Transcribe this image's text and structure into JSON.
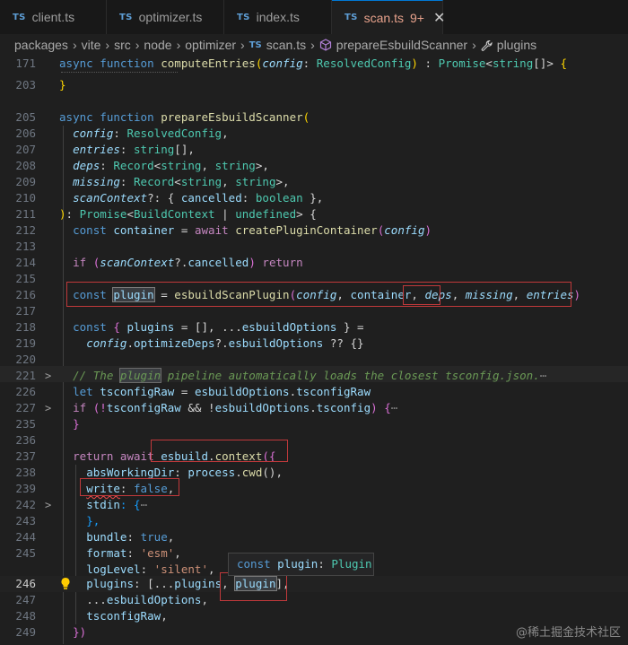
{
  "tabs": [
    {
      "icon": "TS",
      "label": "client.ts"
    },
    {
      "icon": "TS",
      "label": "optimizer.ts"
    },
    {
      "icon": "TS",
      "label": "index.ts"
    },
    {
      "icon": "TS",
      "label": "scan.ts",
      "problems": "9+",
      "close": "✕"
    }
  ],
  "breadcrumb": {
    "parts": [
      "packages",
      "vite",
      "src",
      "node",
      "optimizer"
    ],
    "file_icon": "TS",
    "file": "scan.ts",
    "symbol": "prepareEsbuildScanner",
    "symbol2": "plugins"
  },
  "line_numbers": [
    "171",
    "203",
    "205",
    "206",
    "207",
    "208",
    "209",
    "210",
    "211",
    "212",
    "213",
    "214",
    "215",
    "216",
    "217",
    "218",
    "219",
    "220",
    "221",
    "226",
    "227",
    "235",
    "236",
    "237",
    "238",
    "239",
    "242",
    "243",
    "244",
    "245",
    "246",
    "247",
    "248",
    "249"
  ],
  "code": {
    "l171": [
      "async",
      "function",
      "computeEntries",
      "(",
      "config",
      ":",
      "ResolvedConfig",
      ")",
      ":",
      "Promise",
      "<",
      "string",
      "[]>",
      "{"
    ],
    "l203": [
      "}"
    ],
    "l205": [
      "async",
      "function",
      "prepareEsbuildScanner",
      "("
    ],
    "l206": [
      "config",
      ": ",
      "ResolvedConfig",
      ","
    ],
    "l207": [
      "entries",
      ": ",
      "string",
      "[],"
    ],
    "l208": [
      "deps",
      ": ",
      "Record",
      "<",
      "string",
      ", ",
      "string",
      ">,"
    ],
    "l209": [
      "missing",
      ": ",
      "Record",
      "<",
      "string",
      ", ",
      "string",
      ">,"
    ],
    "l210": [
      "scanContext",
      "?: { ",
      "cancelled",
      ": ",
      "boolean",
      " },"
    ],
    "l211": [
      ")",
      ": ",
      "Promise",
      "<",
      "BuildContext",
      " | ",
      "undefined",
      "> {"
    ],
    "l212": [
      "const",
      "container",
      " = ",
      "await",
      "createPluginContainer",
      "(",
      "config",
      ")"
    ],
    "l214": [
      "if",
      " (",
      "scanContext",
      "?.",
      "cancelled",
      ") ",
      "return"
    ],
    "l216": [
      "const",
      "plugin",
      " = ",
      "esbuildScanPlugin",
      "(",
      "config",
      ", ",
      "container",
      ", ",
      "deps",
      ", ",
      "missing",
      ", ",
      "entries",
      ")"
    ],
    "l218": [
      "const",
      " { ",
      "plugins",
      " = [], ...",
      "esbuildOptions",
      " } ="
    ],
    "l219": [
      "config",
      ".",
      "optimizeDeps",
      "?.",
      "esbuildOptions",
      " ?? {}"
    ],
    "l221": [
      "// The ",
      "plugin",
      " pipeline automatically loads the closest tsconfig.json.",
      "⋯"
    ],
    "l226": [
      "let",
      "tsconfigRaw",
      " = ",
      "esbuildOptions",
      ".",
      "tsconfigRaw"
    ],
    "l227": [
      "if",
      " (!",
      "tsconfigRaw",
      " && !",
      "esbuildOptions",
      ".",
      "tsconfig",
      ") {",
      "⋯"
    ],
    "l235": [
      "}"
    ],
    "l237": [
      "return",
      "await",
      "esbuild",
      ".",
      "context",
      "({"
    ],
    "l238": [
      "absWorkingDir",
      ": ",
      "process",
      ".",
      "cwd",
      "(),"
    ],
    "l239": [
      "write",
      ": ",
      "false",
      ","
    ],
    "l240": [
      "stdin",
      ": {",
      "⋯"
    ],
    "l242": [
      "},"
    ],
    "l243": [
      "bundle",
      ": ",
      "true",
      ","
    ],
    "l244": [
      "format",
      ": ",
      "'esm'",
      ","
    ],
    "l245": [
      "logLevel",
      ": ",
      "'silent'",
      ","
    ],
    "l246": [
      "plugins",
      ": [...",
      "plugins",
      ", ",
      "plugin",
      "],"
    ],
    "l247": [
      "...",
      "esbuildOptions",
      ","
    ],
    "l248": [
      "tsconfigRaw",
      ","
    ],
    "l249": [
      "})"
    ]
  },
  "hover": {
    "kw": "const",
    "name": "plugin",
    ":": ": ",
    "type": "Plugin"
  },
  "watermark": "@稀土掘金技术社区",
  "fold_marker": ">",
  "lightbulb_icon": "lightbulb-icon",
  "colors": {
    "keyword": "#569cd6",
    "function": "#dcdcaa",
    "type": "#4ec9b0",
    "parameter": "#9cdcfe",
    "string": "#ce9178",
    "comment": "#6a9955",
    "annotation": "#c0393b"
  }
}
